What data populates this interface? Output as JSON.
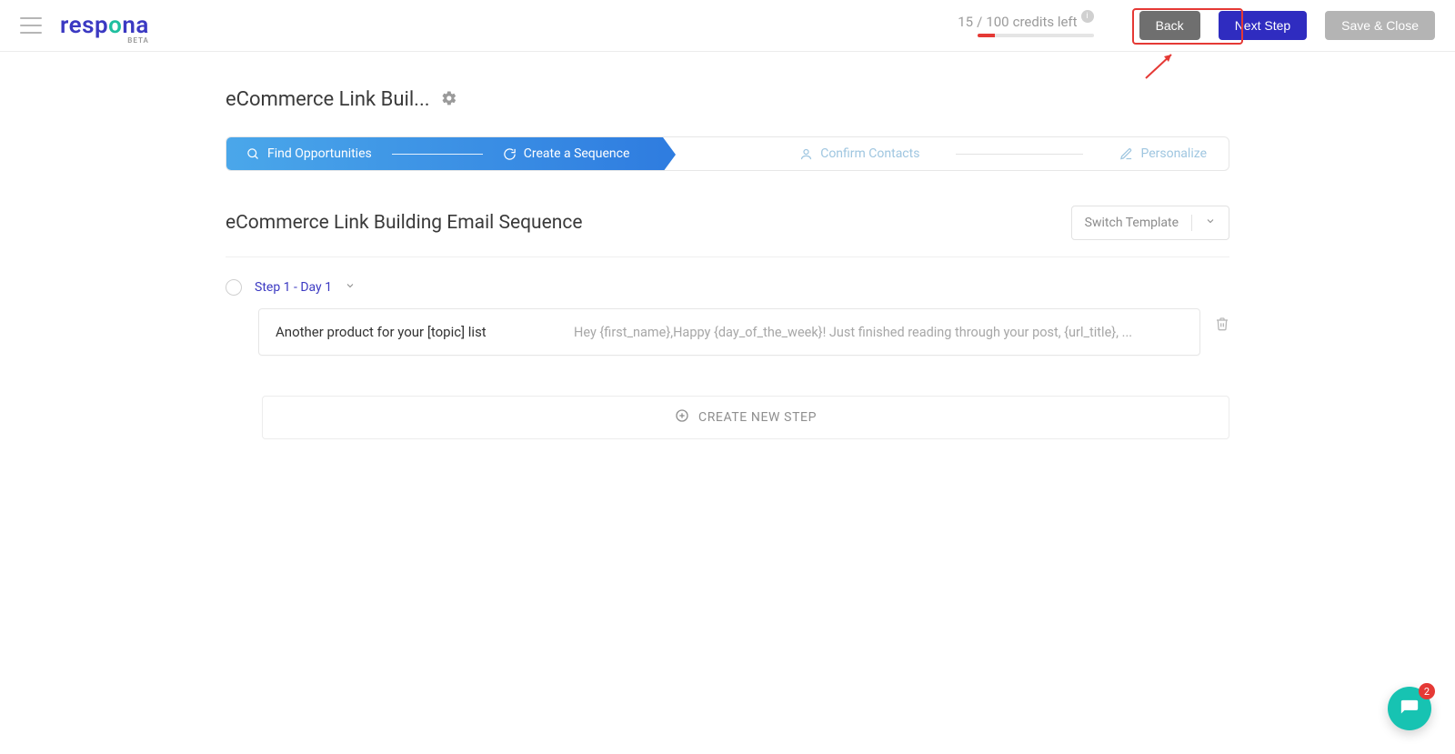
{
  "header": {
    "logo_text": "respona",
    "logo_badge": "BETA",
    "credits_used": "15",
    "credits_total": "100",
    "credits_label": "credits left",
    "back_label": "Back",
    "next_label": "Next Step",
    "save_label": "Save & Close"
  },
  "campaign": {
    "title": "eCommerce Link Buil..."
  },
  "stepper": {
    "step1": "Find Opportunities",
    "step2": "Create a Sequence",
    "step3": "Confirm Contacts",
    "step4": "Personalize"
  },
  "section": {
    "title": "eCommerce Link Building Email Sequence",
    "switch_template": "Switch Template"
  },
  "sequence": {
    "step_label": "Step 1 - Day 1",
    "subject": "Another product for your [topic] list",
    "preview": "Hey {first_name},Happy {day_of_the_week}! Just finished reading through your post, {url_title}, ...",
    "create_new": "CREATE NEW STEP"
  },
  "chat": {
    "badge": "2"
  }
}
